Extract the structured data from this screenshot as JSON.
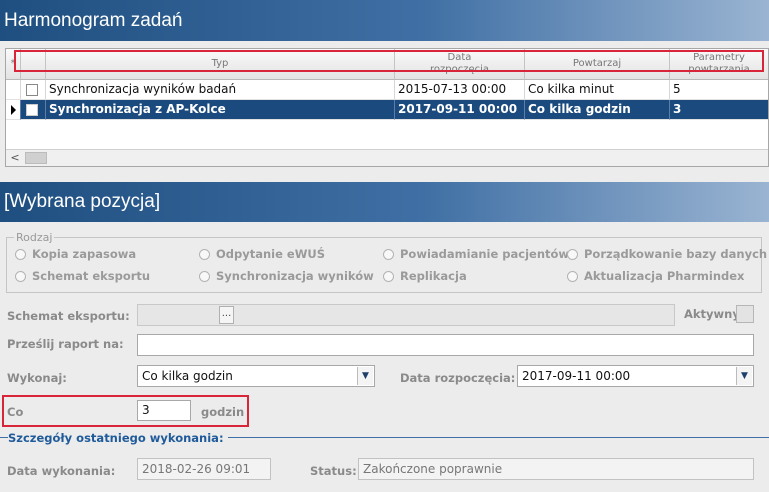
{
  "header": {
    "title": "Harmonogram zadań"
  },
  "grid": {
    "star": "*",
    "columns": {
      "typ": "Typ",
      "data_line1": "Data",
      "data_line2": "rozpoczęcia",
      "powtarzaj": "Powtarzaj",
      "param_line1": "Parametry",
      "param_line2": "powtarzania"
    },
    "rows": [
      {
        "typ": "Synchronizacja wyników badań",
        "data": "2015-07-13 00:00",
        "powtarzaj": "Co kilka minut",
        "parametry": "5"
      },
      {
        "typ": "Synchronizacja z AP-Kolce",
        "data": "2017-09-11 00:00",
        "powtarzaj": "Co kilka godzin",
        "parametry": "3"
      }
    ],
    "scroll_left": "<"
  },
  "selected": {
    "title": "[Wybrana pozycja]",
    "rodzaj": {
      "legend": "Rodzaj",
      "options": [
        "Kopia zapasowa",
        "Odpytanie eWUŚ",
        "Powiadamianie pacjentów",
        "Porządkowanie bazy danych",
        "Schemat eksportu",
        "Synchronizacja wyników",
        "Replikacja",
        "Aktualizacja Pharmindex"
      ]
    },
    "schemat_label": "Schemat eksportu:",
    "schemat_value": "",
    "ellipsis": "...",
    "aktywny_label": "Aktywny",
    "przeslij_label": "Prześlij raport na:",
    "przeslij_value": "",
    "wykonaj_label": "Wykonaj:",
    "wykonaj_value": "Co kilka godzin",
    "data_rozp_label": "Data rozpoczęcia:",
    "data_rozp_value": "2017-09-11 00:00",
    "co_label": "Co",
    "co_value": "3",
    "co_unit": "godzin",
    "details": {
      "title": "Szczegóły ostatniego wykonania:",
      "data_label": "Data wykonania:",
      "data_value": "2018-02-26 09:01",
      "status_label": "Status:",
      "status_value": "Zakończone poprawnie"
    },
    "dropdown_arrow": "▼"
  },
  "colors": {
    "header_dark": "#1f4f80",
    "selected_row": "#1a4a7e",
    "highlight": "#d9253a",
    "section_title": "#1f5b9a"
  }
}
